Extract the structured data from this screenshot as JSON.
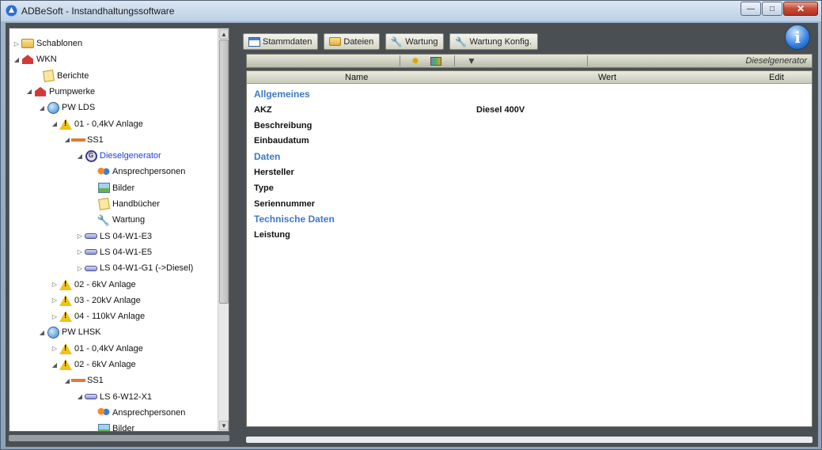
{
  "window": {
    "title": "ADBeSoft - Instandhaltungssoftware",
    "controls": {
      "minimize": "—",
      "maximize": "□",
      "close": "✕"
    }
  },
  "tree": {
    "nodes": [
      {
        "label": "Schablonen",
        "icon": "folder-icon",
        "arrow": "▷"
      },
      {
        "label": "WKN",
        "icon": "house-icon",
        "arrow": "◢"
      },
      {
        "label": "Berichte",
        "icon": "note-icon",
        "arrow": ""
      },
      {
        "label": "Pumpwerke",
        "icon": "house-icon",
        "arrow": "◢"
      },
      {
        "label": "PW LDS",
        "icon": "globe-icon",
        "arrow": "◢"
      },
      {
        "label": "01 - 0,4kV Anlage",
        "icon": "warning-icon",
        "arrow": "◢"
      },
      {
        "label": "SS1",
        "icon": "busbar-icon",
        "arrow": "◢"
      },
      {
        "label": "Dieselgenerator",
        "icon": "generator-icon",
        "arrow": "◢"
      },
      {
        "label": "Ansprechpersonen",
        "icon": "people-icon",
        "arrow": ""
      },
      {
        "label": "Bilder",
        "icon": "picture-icon",
        "arrow": ""
      },
      {
        "label": "Handbücher",
        "icon": "note-icon",
        "arrow": ""
      },
      {
        "label": "Wartung",
        "icon": "wrench-icon",
        "arrow": ""
      },
      {
        "label": "LS 04-W1-E3",
        "icon": "switch-icon",
        "arrow": "▷"
      },
      {
        "label": "LS 04-W1-E5",
        "icon": "switch-icon",
        "arrow": "▷"
      },
      {
        "label": "LS 04-W1-G1 (->Diesel)",
        "icon": "switch-icon",
        "arrow": "▷"
      },
      {
        "label": "02 - 6kV Anlage",
        "icon": "warning-icon",
        "arrow": "▷"
      },
      {
        "label": "03 - 20kV Anlage",
        "icon": "warning-icon",
        "arrow": "▷"
      },
      {
        "label": "04 - 110kV Anlage",
        "icon": "warning-icon",
        "arrow": "▷"
      },
      {
        "label": "PW LHSK",
        "icon": "globe-icon",
        "arrow": "◢"
      },
      {
        "label": "01 - 0,4kV Anlage",
        "icon": "warning-icon",
        "arrow": "▷"
      },
      {
        "label": "02 - 6kV Anlage",
        "icon": "warning-icon",
        "arrow": "◢"
      },
      {
        "label": "SS1",
        "icon": "busbar-icon",
        "arrow": "◢"
      },
      {
        "label": "LS 6-W12-X1",
        "icon": "switch-icon",
        "arrow": "◢"
      },
      {
        "label": "Ansprechpersonen",
        "icon": "people-icon",
        "arrow": ""
      },
      {
        "label": "Bilder",
        "icon": "picture-icon",
        "arrow": ""
      }
    ],
    "selected": "Dieselgenerator"
  },
  "tabs": [
    {
      "label": "Stammdaten",
      "icon": "document-icon"
    },
    {
      "label": "Dateien",
      "icon": "folder-icon"
    },
    {
      "label": "Wartung",
      "icon": "wrench-icon"
    },
    {
      "label": "Wartung Konfig.",
      "icon": "wrench-icon"
    }
  ],
  "info_button": "i",
  "toolstrip": {
    "breadcrumb": "Dieselgenerator"
  },
  "grid": {
    "headers": {
      "name": "Name",
      "value": "Wert",
      "edit": "Edit"
    },
    "rows": [
      {
        "type": "category",
        "name": "Allgemeines",
        "value": ""
      },
      {
        "type": "property",
        "name": "AKZ",
        "value": "Diesel 400V"
      },
      {
        "type": "property",
        "name": "Beschreibung",
        "value": ""
      },
      {
        "type": "property",
        "name": "Einbaudatum",
        "value": ""
      },
      {
        "type": "category",
        "name": "Daten",
        "value": ""
      },
      {
        "type": "property",
        "name": "Hersteller",
        "value": ""
      },
      {
        "type": "property",
        "name": "Type",
        "value": ""
      },
      {
        "type": "property",
        "name": "Seriennummer",
        "value": ""
      },
      {
        "type": "category",
        "name": "Technische Daten",
        "value": ""
      },
      {
        "type": "property",
        "name": "Leistung",
        "value": ""
      }
    ]
  },
  "colors": {
    "category": "#3d78c8",
    "selected_tree_item": "#1a3ee0",
    "client_background": "#4a4f53"
  }
}
